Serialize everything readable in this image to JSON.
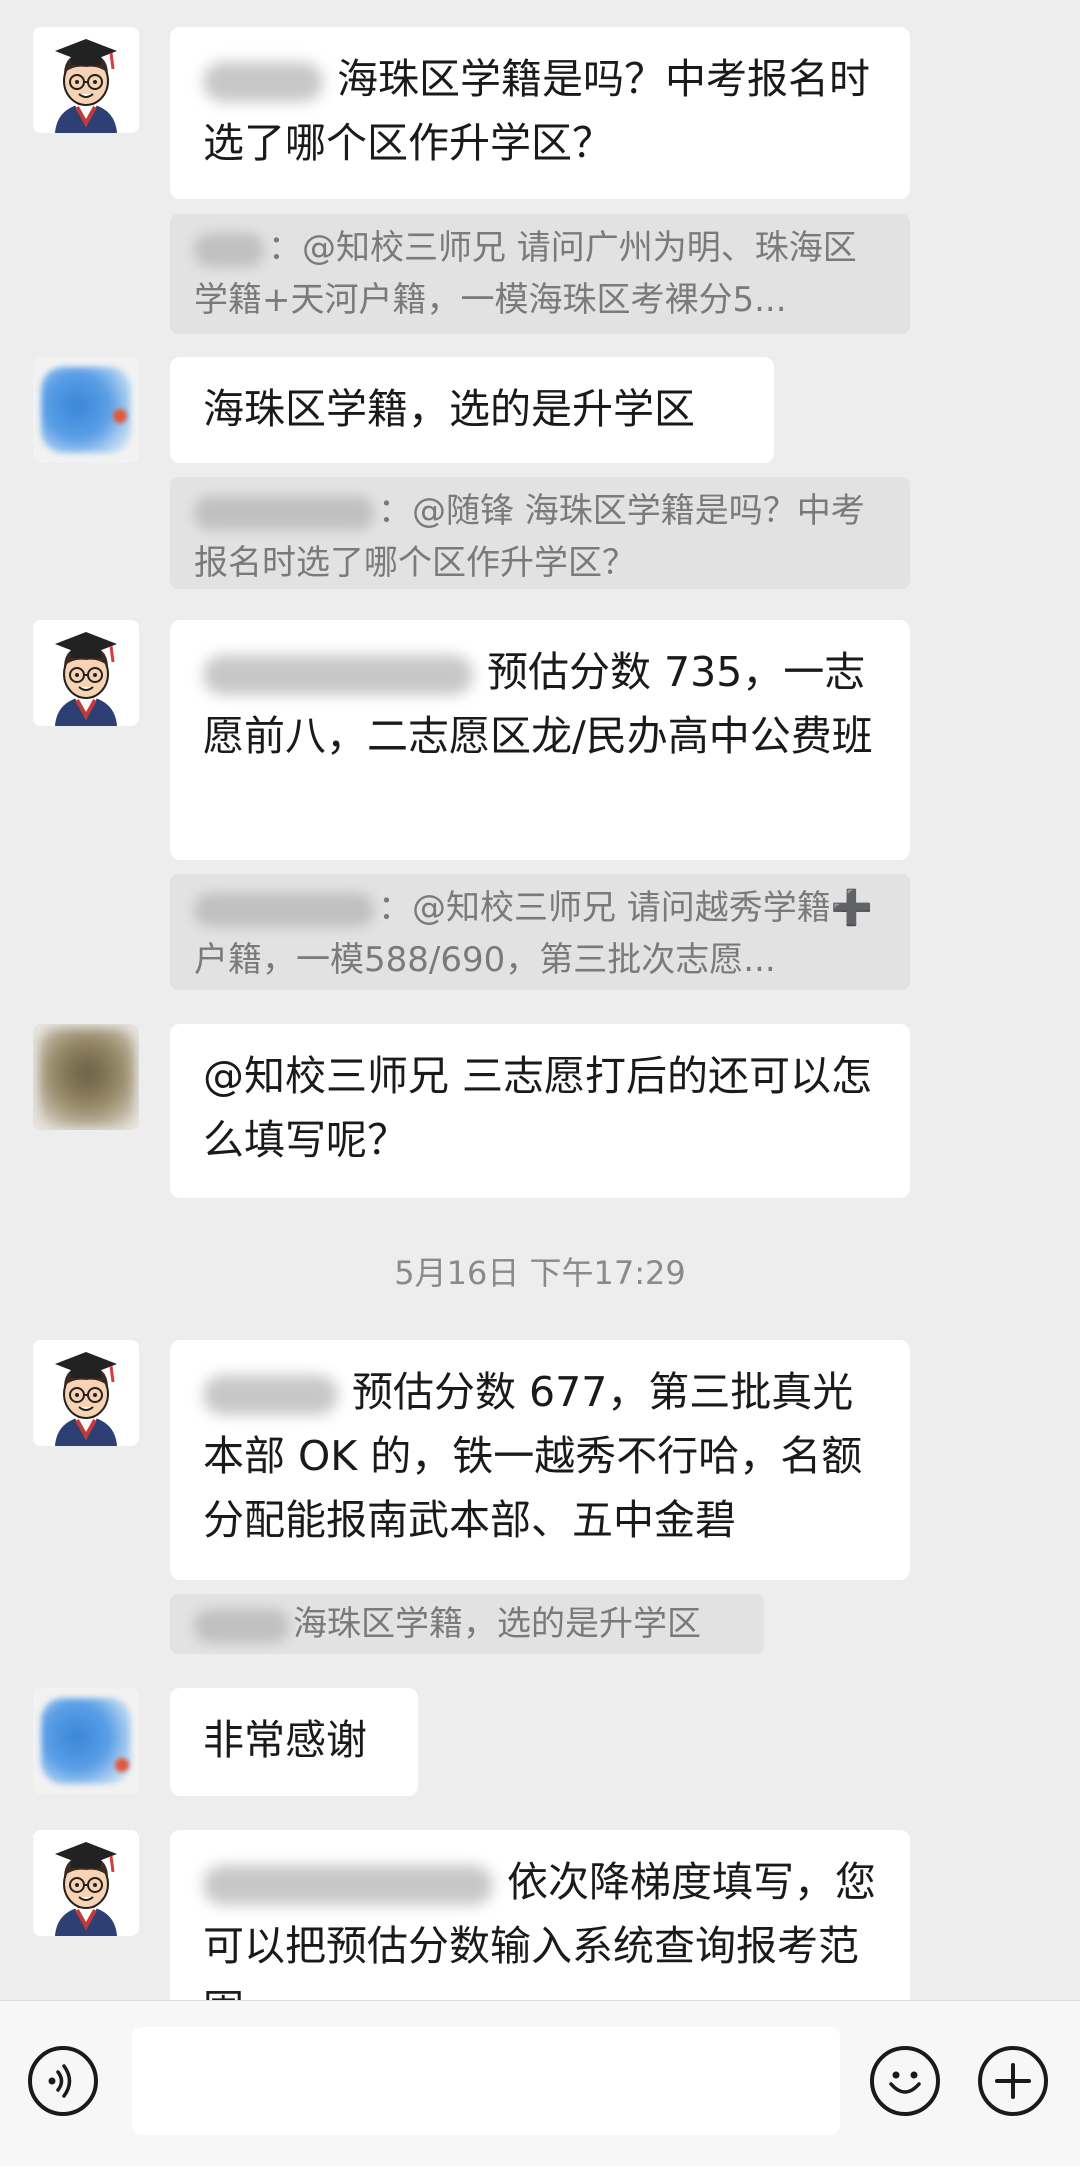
{
  "messages": [
    {
      "text_after_name": "海珠区学籍是吗？中考报名时选了哪个区作升学区？",
      "quote": "：@知校三师兄 请问广州为明、珠海区学籍+天河户籍，一模海珠区考裸分5..."
    },
    {
      "text": "海珠区学籍，选的是升学区",
      "quote": "：@随锋 海珠区学籍是吗？中考报名时选了哪个区作升学区？"
    },
    {
      "text_after_name": "预估分数 735，一志愿前八，二志愿区龙/民办高中公费班",
      "quote": "：@知校三师兄 请问越秀学籍➕户籍，一模588/690，第三批次志愿..."
    },
    {
      "text": "@知校三师兄  三志愿打后的还可以怎么填写呢？"
    },
    {
      "text_after_name": "预估分数 677，第三批真光本部 OK 的，铁一越秀不行哈，名额分配能报南武本部、五中金碧",
      "quote": "海珠区学籍，选的是升学区"
    },
    {
      "text": "非常感谢"
    },
    {
      "text_after_name": "依次降梯度填写，您可以把预估分数输入系统查询报考范围"
    }
  ],
  "timestamp": "5月16日 下午17:29",
  "icons": {
    "voice": "voice-icon",
    "emoji": "emoji-icon",
    "plus": "plus-icon",
    "avatar_teacher": "graduate-avatar-icon"
  },
  "colors": {
    "background": "#ededed",
    "bubble": "#ffffff",
    "quote": "#e2e2e2"
  }
}
